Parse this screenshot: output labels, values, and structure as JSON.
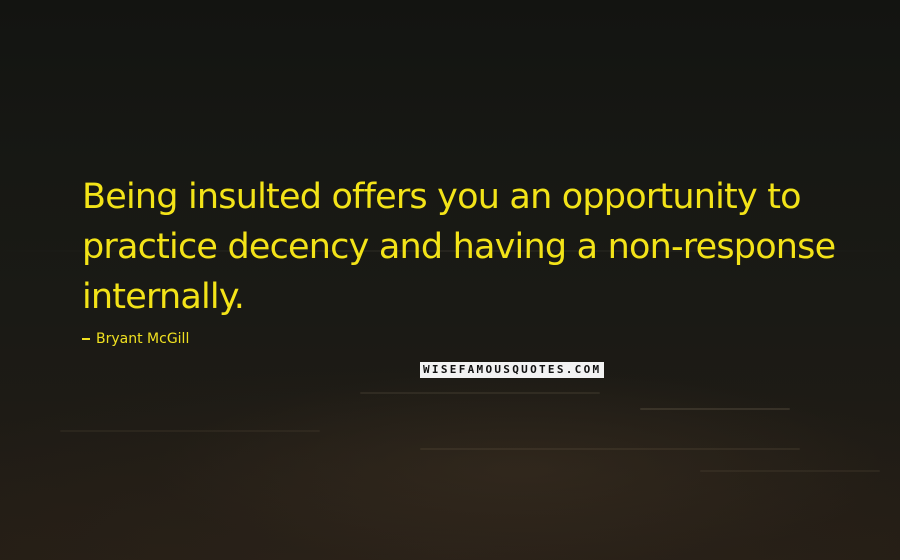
{
  "quote": {
    "text": "Being insulted offers you an opportunity to practice decency and having a non-response internally."
  },
  "author": {
    "name": "Bryant McGill"
  },
  "watermark": {
    "text": "WISEFAMOUSQUOTES.COM"
  },
  "colors": {
    "quote_text": "#f3e318",
    "background": "#15130f"
  }
}
